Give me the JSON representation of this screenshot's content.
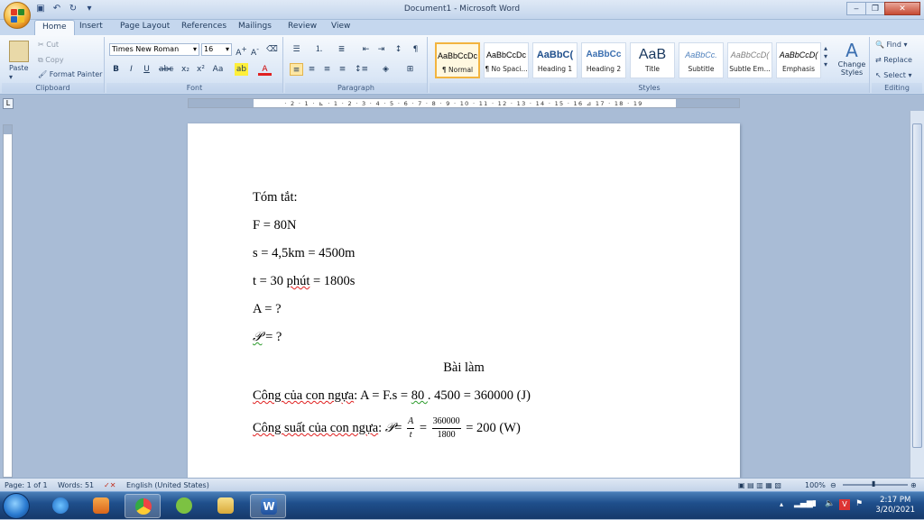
{
  "window": {
    "title": "Document1 - Microsoft Word"
  },
  "tabs": [
    "Home",
    "Insert",
    "Page Layout",
    "References",
    "Mailings",
    "Review",
    "View"
  ],
  "clipboard": {
    "paste": "Paste",
    "cut": "Cut",
    "copy": "Copy",
    "format_painter": "Format Painter",
    "label": "Clipboard"
  },
  "font": {
    "name": "Times New Roman",
    "size": "16",
    "label": "Font"
  },
  "paragraph": {
    "label": "Paragraph"
  },
  "styles": {
    "label": "Styles",
    "items": [
      {
        "preview": "AaBbCcDc",
        "name": "¶ Normal"
      },
      {
        "preview": "AaBbCcDc",
        "name": "¶ No Spaci..."
      },
      {
        "preview": "AaBbC(",
        "name": "Heading 1"
      },
      {
        "preview": "AaBbCc",
        "name": "Heading 2"
      },
      {
        "preview": "AaB",
        "name": "Title"
      },
      {
        "preview": "AaBbCc.",
        "name": "Subtitle"
      },
      {
        "preview": "AaBbCcD(",
        "name": "Subtle Em..."
      },
      {
        "preview": "AaBbCcD(",
        "name": "Emphasis"
      }
    ],
    "change_styles": "Change Styles"
  },
  "editing": {
    "find": "Find",
    "replace": "Replace",
    "select": "Select",
    "label": "Editing"
  },
  "ruler": {
    "numbers": "· 2 · 1 · ⊾ · 1 · 2 · 3 · 4 · 5 · 6 · 7 · 8 · 9 · 10 · 11 · 12 · 13 · 14 · 15 · 16 ⊿ 17 · 18 · 19"
  },
  "document": {
    "l1": "Tóm tắt:",
    "l2": "F = 80N",
    "l3": "s = 4,5km = 4500m",
    "l4a": "t = 30 ",
    "l4b": "phút",
    "l4c": " = 1800s",
    "l5": "A = ?",
    "l6a": "𝒫",
    "l6b": " = ?",
    "heading": "Bài làm",
    "l8a": "Công của con ngựa",
    "l8b": ": A = F.s = ",
    "l8c": "80 ",
    "l8d": ". 4500 = 360000 (J)",
    "l9a": "Công suất của con ngựa",
    "l9b": ": ",
    "l9c": "𝒫",
    "l9d": "= ",
    "frac1_num": "A",
    "frac1_den": "t",
    "l9e": " = ",
    "frac2_num": "360000",
    "frac2_den": "1800",
    "l9f": " = 200 (W)"
  },
  "status": {
    "page": "Page: 1 of 1",
    "words": "Words: 51",
    "language": "English (United States)",
    "zoom": "100%"
  },
  "clock": {
    "time": "2:17 PM",
    "date": "3/20/2021"
  }
}
